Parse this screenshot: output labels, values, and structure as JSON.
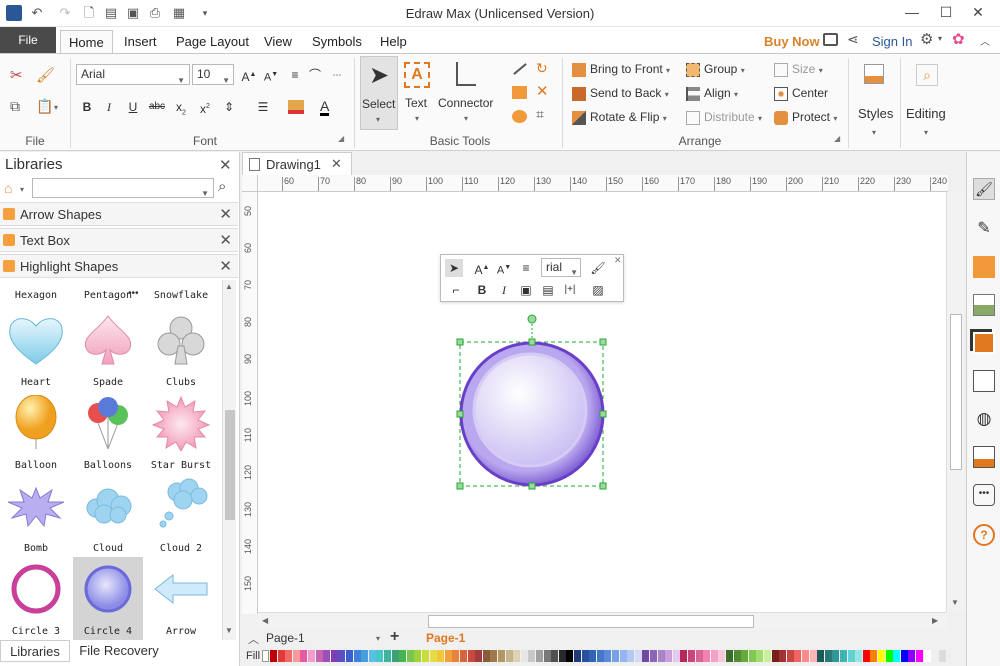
{
  "app": {
    "title": "Edraw Max (Unlicensed Version)"
  },
  "window": {
    "minimize": "—",
    "maximize": "☐",
    "close": "✕"
  },
  "menu": {
    "file": "File",
    "tabs": [
      "Home",
      "Insert",
      "Page Layout",
      "View",
      "Symbols",
      "Help"
    ],
    "buy_now": "Buy Now",
    "sign_in": "Sign In"
  },
  "ribbon": {
    "file_group": {
      "label": "File"
    },
    "font_group": {
      "label": "Font",
      "font_name": "Arial",
      "font_size": "10"
    },
    "tools_group": {
      "label": "Basic Tools",
      "select": "Select",
      "text": "Text",
      "connector": "Connector"
    },
    "arrange_group": {
      "label": "Arrange",
      "bring_to_front": "Bring to Front",
      "send_to_back": "Send to Back",
      "rotate_flip": "Rotate & Flip",
      "group": "Group",
      "align": "Align",
      "distribute": "Distribute",
      "size": "Size",
      "center": "Center",
      "protect": "Protect"
    },
    "styles": "Styles",
    "editing": "Editing"
  },
  "libraries": {
    "title": "Libraries",
    "search_value": "",
    "sections": [
      "Arrow Shapes",
      "Text Box",
      "Highlight Shapes"
    ],
    "header_row": [
      "Hexagon",
      "Pentagon",
      "Snowflake"
    ],
    "shapes": [
      {
        "label": "Heart",
        "icon": "heart-icon"
      },
      {
        "label": "Spade",
        "icon": "spade-icon"
      },
      {
        "label": "Clubs",
        "icon": "clubs-icon"
      },
      {
        "label": "Balloon",
        "icon": "balloon-icon"
      },
      {
        "label": "Balloons",
        "icon": "balloons-icon"
      },
      {
        "label": "Star Burst",
        "icon": "star-burst-icon"
      },
      {
        "label": "Bomb",
        "icon": "bomb-icon"
      },
      {
        "label": "Cloud",
        "icon": "cloud-icon"
      },
      {
        "label": "Cloud 2",
        "icon": "cloud-2-icon"
      },
      {
        "label": "Circle 3",
        "icon": "circle-3-icon"
      },
      {
        "label": "Circle 4",
        "icon": "circle-4-icon"
      },
      {
        "label": "Arrow",
        "icon": "arrow-icon"
      }
    ],
    "bottom_tabs": [
      "Libraries",
      "File Recovery"
    ]
  },
  "document": {
    "tab_name": "Drawing1",
    "hruler": [
      "60",
      "70",
      "80",
      "90",
      "100",
      "110",
      "120",
      "130",
      "140",
      "150",
      "160",
      "170",
      "180",
      "190",
      "200",
      "210",
      "220",
      "230",
      "240"
    ],
    "vruler": [
      "50",
      "60",
      "70",
      "80",
      "90",
      "100",
      "110",
      "120",
      "130",
      "140",
      "150"
    ],
    "mini_toolbar_font": "rial",
    "selected_shape": "Circle 4"
  },
  "pages": {
    "current": "Page-1",
    "tab": "Page-1"
  },
  "fill_label": "Fill",
  "colors": {
    "accent": "#2b5797",
    "buy_now": "#d9822b",
    "circle_outer": "#7b5bd6",
    "circle_inner": "#ece6fb",
    "selection": "#22aa33",
    "palette": [
      "#c00000",
      "#e03c3c",
      "#f06a6a",
      "#f59a9a",
      "#e85aa0",
      "#f0a0c8",
      "#c864b4",
      "#a04db4",
      "#7b3fb0",
      "#5a4fc4",
      "#3a5fd0",
      "#3c82d8",
      "#46a0e0",
      "#5ac0e8",
      "#46c8c8",
      "#3cb4a0",
      "#3ca078",
      "#46b450",
      "#78c850",
      "#a0d23c",
      "#c8dc3c",
      "#e6dc46",
      "#f0c83c",
      "#f0a03c",
      "#e8823c",
      "#d8643c",
      "#c84a3c",
      "#a03c3c",
      "#8c5a3c",
      "#a07850",
      "#b49664",
      "#c8b48c",
      "#dcd2b4",
      "#e6e6e6",
      "#c8c8c8",
      "#a0a0a0",
      "#787878",
      "#505050",
      "#282828",
      "#000000",
      "#1e3c78",
      "#2850a0",
      "#3264b4",
      "#4678c8",
      "#5a8cdc",
      "#78a0e6",
      "#96b4f0",
      "#b4c8f0",
      "#d2dcf5",
      "#6e4aa0",
      "#8c64b4",
      "#aa82c8",
      "#c8a0dc",
      "#e6c8f0",
      "#b4285a",
      "#c84678",
      "#dc6496",
      "#f082b4",
      "#f5a0c8",
      "#fac8dc",
      "#3c6e28",
      "#508c32",
      "#64aa3c",
      "#82c850",
      "#a0dc6e",
      "#c8f096",
      "#781e1e",
      "#a03232",
      "#c84646",
      "#f06464",
      "#ff8c8c",
      "#ffb4b4",
      "#1e5a5a",
      "#287878",
      "#329696",
      "#3cb4b4",
      "#64d2d2",
      "#96e6e6",
      "#ff0000",
      "#ff7f00",
      "#ffff00",
      "#00ff00",
      "#00ffff",
      "#0000ff",
      "#8b00ff",
      "#ff00ff",
      "#ffffff",
      "#f0f0f0",
      "#dcdcdc"
    ]
  }
}
